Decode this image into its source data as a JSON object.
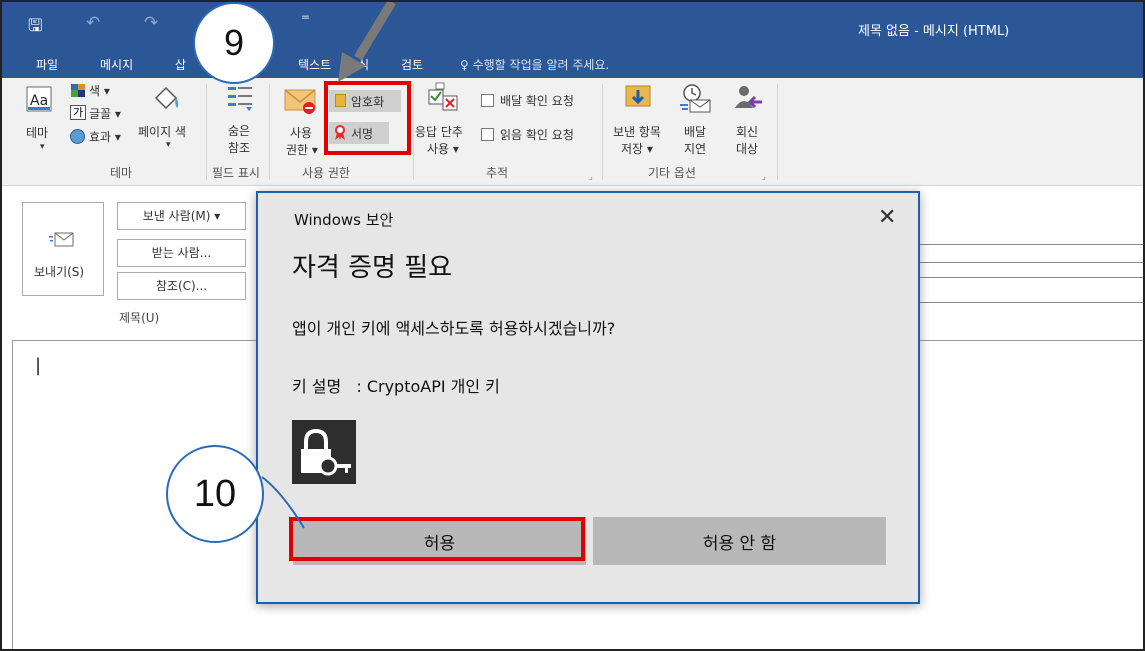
{
  "titlebar": {
    "window_title": "제목 없음 - 메시지 (HTML)",
    "qa_symbols": [
      "🖫",
      "↶",
      "↷",
      "⁼"
    ]
  },
  "tabs": {
    "file": "파일",
    "message": "메시지",
    "insert_partial": "삽",
    "format_text": "텍스트",
    "format_tail": "식",
    "review": "검토",
    "tell_me": "♀ 수행할 작업을 알려 주세요."
  },
  "ribbon": {
    "theme": {
      "themes_label": "테마",
      "colors": "색 ▾",
      "fonts": "글꼴 ▾",
      "effects": "효과 ▾",
      "page_color": "페이지 색",
      "group": "테마"
    },
    "show_fields": {
      "bcc_line1": "숨은",
      "bcc_line2": "참조",
      "group": "필드 표시"
    },
    "permission": {
      "perm_line1": "사용",
      "perm_line2": "권한 ▾",
      "encrypt": "암호화",
      "sign": "서명",
      "group": "사용 권한"
    },
    "tracking": {
      "voting_line1": "응답 단추",
      "voting_line2": "사용 ▾",
      "delivery_receipt": "배달 확인 요청",
      "read_receipt": "읽음 확인 요청",
      "group": "추적"
    },
    "more_options": {
      "save_sent_line1": "보낸 항목",
      "save_sent_line2": "저장 ▾",
      "delay_line1": "배달",
      "delay_line2": "지연",
      "reply_line1": "회신",
      "reply_line2": "대상",
      "group": "기타 옵션"
    }
  },
  "compose": {
    "send": "보내기(S)",
    "from": "보낸 사람(M) ▾",
    "to": "받는 사람...",
    "cc": "참조(C)...",
    "subject": "제목(U)",
    "cursor": "|"
  },
  "dialog": {
    "app_name": "Windows 보안",
    "close": "✕",
    "heading": "자격 증명 필요",
    "question": "앱이 개인 키에 액세스하도록 허용하시겠습니까?",
    "key_desc_label": "키 설명",
    "key_desc_value": ": CryptoAPI 개인 키",
    "allow": "허용",
    "deny": "허용 안 함"
  },
  "annotations": {
    "step9": "9",
    "step10": "10",
    "highlight_color": "#e00000",
    "callout_border": "#2a6bb5"
  },
  "colors": {
    "titlebar": "#2b5797",
    "dialog_border": "#1d5fa8",
    "dialog_bg": "#e6e6e6",
    "button_bg": "#b8b8b8"
  }
}
